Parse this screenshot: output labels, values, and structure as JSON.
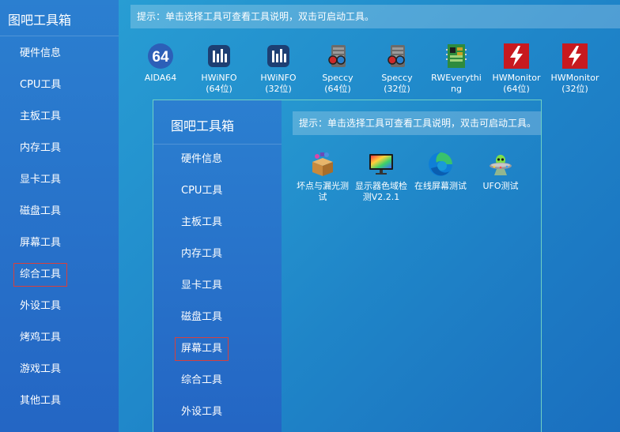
{
  "back": {
    "app_title": "图吧工具箱",
    "hint": "提示：单击选择工具可查看工具说明，双击可启动工具。",
    "menu": [
      {
        "label": "硬件信息",
        "selected": false
      },
      {
        "label": "CPU工具",
        "selected": false
      },
      {
        "label": "主板工具",
        "selected": false
      },
      {
        "label": "内存工具",
        "selected": false
      },
      {
        "label": "显卡工具",
        "selected": false
      },
      {
        "label": "磁盘工具",
        "selected": false
      },
      {
        "label": "屏幕工具",
        "selected": false
      },
      {
        "label": "综合工具",
        "selected": true
      },
      {
        "label": "外设工具",
        "selected": false
      },
      {
        "label": "烤鸡工具",
        "selected": false
      },
      {
        "label": "游戏工具",
        "selected": false
      },
      {
        "label": "其他工具",
        "selected": false
      }
    ],
    "tools": [
      {
        "label": "AIDA64",
        "sub": "",
        "icon": "aida64-icon"
      },
      {
        "label": "HWiNFO",
        "sub": "(64位)",
        "icon": "hwinfo-icon"
      },
      {
        "label": "HWiNFO",
        "sub": "(32位)",
        "icon": "hwinfo-icon"
      },
      {
        "label": "Speccy",
        "sub": "(64位)",
        "icon": "speccy-icon"
      },
      {
        "label": "Speccy",
        "sub": "(32位)",
        "icon": "speccy-icon"
      },
      {
        "label": "RWEverythi",
        "sub": "ng",
        "icon": "rweverything-icon"
      },
      {
        "label": "HWMonitor",
        "sub": "(64位)",
        "icon": "hwmonitor-icon"
      },
      {
        "label": "HWMonitor",
        "sub": "(32位)",
        "icon": "hwmonitor-icon"
      }
    ]
  },
  "front": {
    "app_title": "图吧工具箱",
    "hint": "提示：单击选择工具可查看工具说明，双击可启动工具。",
    "menu": [
      {
        "label": "硬件信息",
        "selected": false
      },
      {
        "label": "CPU工具",
        "selected": false
      },
      {
        "label": "主板工具",
        "selected": false
      },
      {
        "label": "内存工具",
        "selected": false
      },
      {
        "label": "显卡工具",
        "selected": false
      },
      {
        "label": "磁盘工具",
        "selected": false
      },
      {
        "label": "屏幕工具",
        "selected": true
      },
      {
        "label": "综合工具",
        "selected": false
      },
      {
        "label": "外设工具",
        "selected": false
      }
    ],
    "tools": [
      {
        "label": "坏点与漏光测",
        "sub": "试",
        "icon": "dead-pixel-box-icon"
      },
      {
        "label": "显示器色域检",
        "sub": "测V2.2.1",
        "icon": "monitor-gamut-icon"
      },
      {
        "label": "在线屏幕测试",
        "sub": "",
        "icon": "edge-browser-icon"
      },
      {
        "label": "UFO测试",
        "sub": "",
        "icon": "ufo-icon"
      }
    ]
  },
  "colors": {
    "selection_border": "#d8403c",
    "window_border": "#6fd0c4"
  }
}
